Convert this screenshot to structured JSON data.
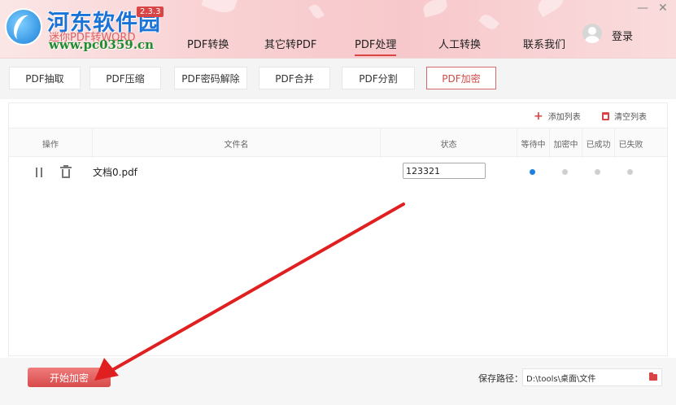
{
  "header": {
    "site_name": "河东软件园",
    "app_name": "迷你PDF转WORD",
    "site_url": "www.pc0359.cn",
    "version": "2.3.3",
    "nav": [
      "PDF转换",
      "其它转PDF",
      "PDF处理",
      "人工转换",
      "联系我们"
    ],
    "active_nav": "PDF处理",
    "login_label": "登录",
    "minimize": "—",
    "close": "✕"
  },
  "tools": {
    "tabs": [
      "PDF抽取",
      "PDF压缩",
      "PDF密码解除",
      "PDF合并",
      "PDF分割",
      "PDF加密"
    ],
    "active": "PDF加密"
  },
  "list": {
    "add_label": "添加列表",
    "clear_label": "清空列表",
    "columns": {
      "action": "操作",
      "filename": "文件名",
      "status": "状态",
      "waiting": "等待中",
      "encrypting": "加密中",
      "success": "已成功",
      "failed": "已失败"
    },
    "rows": [
      {
        "filename": "文档0.pdf",
        "password": "123321",
        "state": "waiting"
      }
    ]
  },
  "footer": {
    "start_label": "开始加密",
    "save_path_label": "保存路径：",
    "save_path": "D:\\tools\\桌面\\文件"
  },
  "colors": {
    "accent": "#d94545",
    "arrow": "#e02020",
    "status_active": "#1e7fe0"
  }
}
